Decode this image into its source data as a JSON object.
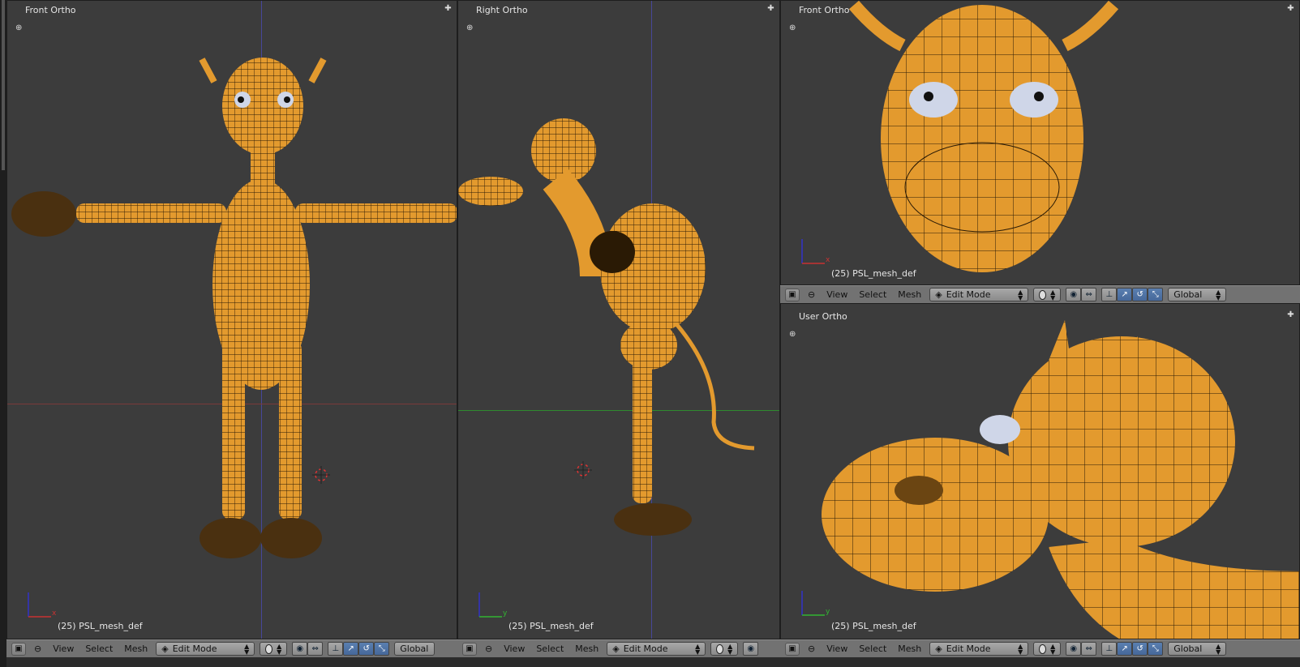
{
  "viewports": [
    {
      "label": "Front Ortho",
      "object_info": "(25) PSL_mesh_def",
      "axis_labels": [
        "x"
      ]
    },
    {
      "label": "Right Ortho",
      "object_info": "(25) PSL_mesh_def",
      "axis_labels": [
        "y"
      ]
    },
    {
      "label": "Front Ortho",
      "object_info": "(25) PSL_mesh_def",
      "axis_labels": [
        "x"
      ]
    },
    {
      "label": "User Ortho",
      "object_info": "(25) PSL_mesh_def",
      "axis_labels": [
        "y"
      ]
    }
  ],
  "header": {
    "menus": [
      "View",
      "Select",
      "Mesh"
    ],
    "mode": "Edit Mode",
    "orientation": "Global"
  },
  "colors": {
    "viewport_bg": "#3c3c3c",
    "header_bg": "#727272",
    "mesh": "#e0972c",
    "mesh_wire": "#2a1a05",
    "axis_x": "#c83232",
    "axis_y": "#32b432",
    "axis_z": "#3232c8"
  },
  "icons": [
    "viewport-type-icon",
    "view-menu-toggle-icon",
    "mode-icon",
    "shading-icon",
    "pivot-icon",
    "manipulator-icon",
    "translate-icon",
    "rotate-icon",
    "scale-icon",
    "plus-icon",
    "corner-icon",
    "3d-cursor-icon"
  ]
}
